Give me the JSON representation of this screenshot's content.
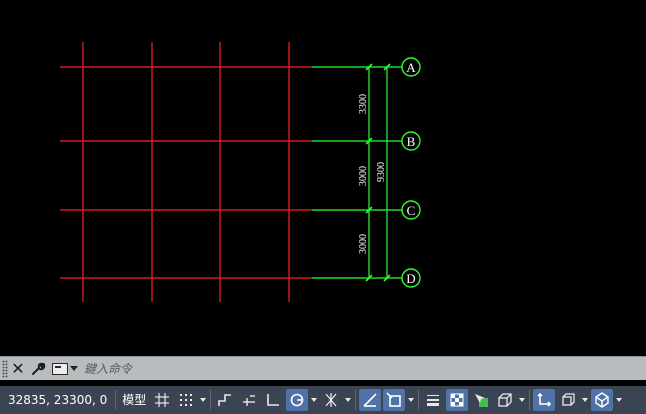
{
  "command_line": {
    "placeholder": "鍵入命令",
    "close_icon": "close-icon",
    "settings_icon": "wrench-icon",
    "prompt_icon": "command-prompt-icon"
  },
  "status_bar": {
    "coordinates": "32835, 23300, 0",
    "model_tab": "模型",
    "buttons": [
      {
        "name": "grid-display-icon"
      },
      {
        "name": "snap-mode-icon"
      },
      {
        "name": "infer-constraints-icon"
      },
      {
        "name": "dynamic-input-icon"
      },
      {
        "name": "ortho-mode-icon"
      },
      {
        "name": "polar-tracking-icon",
        "active": true
      },
      {
        "name": "isometric-drafting-icon"
      },
      {
        "name": "object-snap-tracking-icon",
        "active": true
      },
      {
        "name": "object-snap-icon",
        "active": true
      },
      {
        "name": "lineweight-icon"
      },
      {
        "name": "transparency-icon",
        "active": true
      },
      {
        "name": "selection-cycling-icon"
      },
      {
        "name": "3d-object-snap-icon"
      },
      {
        "name": "dynamic-ucs-icon",
        "active": true
      },
      {
        "name": "selection-filtering-icon"
      },
      {
        "name": "gizmo-icon",
        "active": true
      }
    ]
  },
  "drawing": {
    "grid_color": "#ff2020",
    "dimension_color": "#2bff2b",
    "text_color": "#ffffff",
    "axes": [
      {
        "label": "A"
      },
      {
        "label": "B"
      },
      {
        "label": "C"
      },
      {
        "label": "D"
      }
    ],
    "dimensions": [
      {
        "text": "3300"
      },
      {
        "text": "3000"
      },
      {
        "text": "3000"
      },
      {
        "text": "9300"
      }
    ]
  },
  "colors": {
    "canvas_bg": "#000000",
    "command_bg": "#b9bcbf",
    "status_bg": "#3b4453",
    "status_active": "#4f73a7"
  }
}
